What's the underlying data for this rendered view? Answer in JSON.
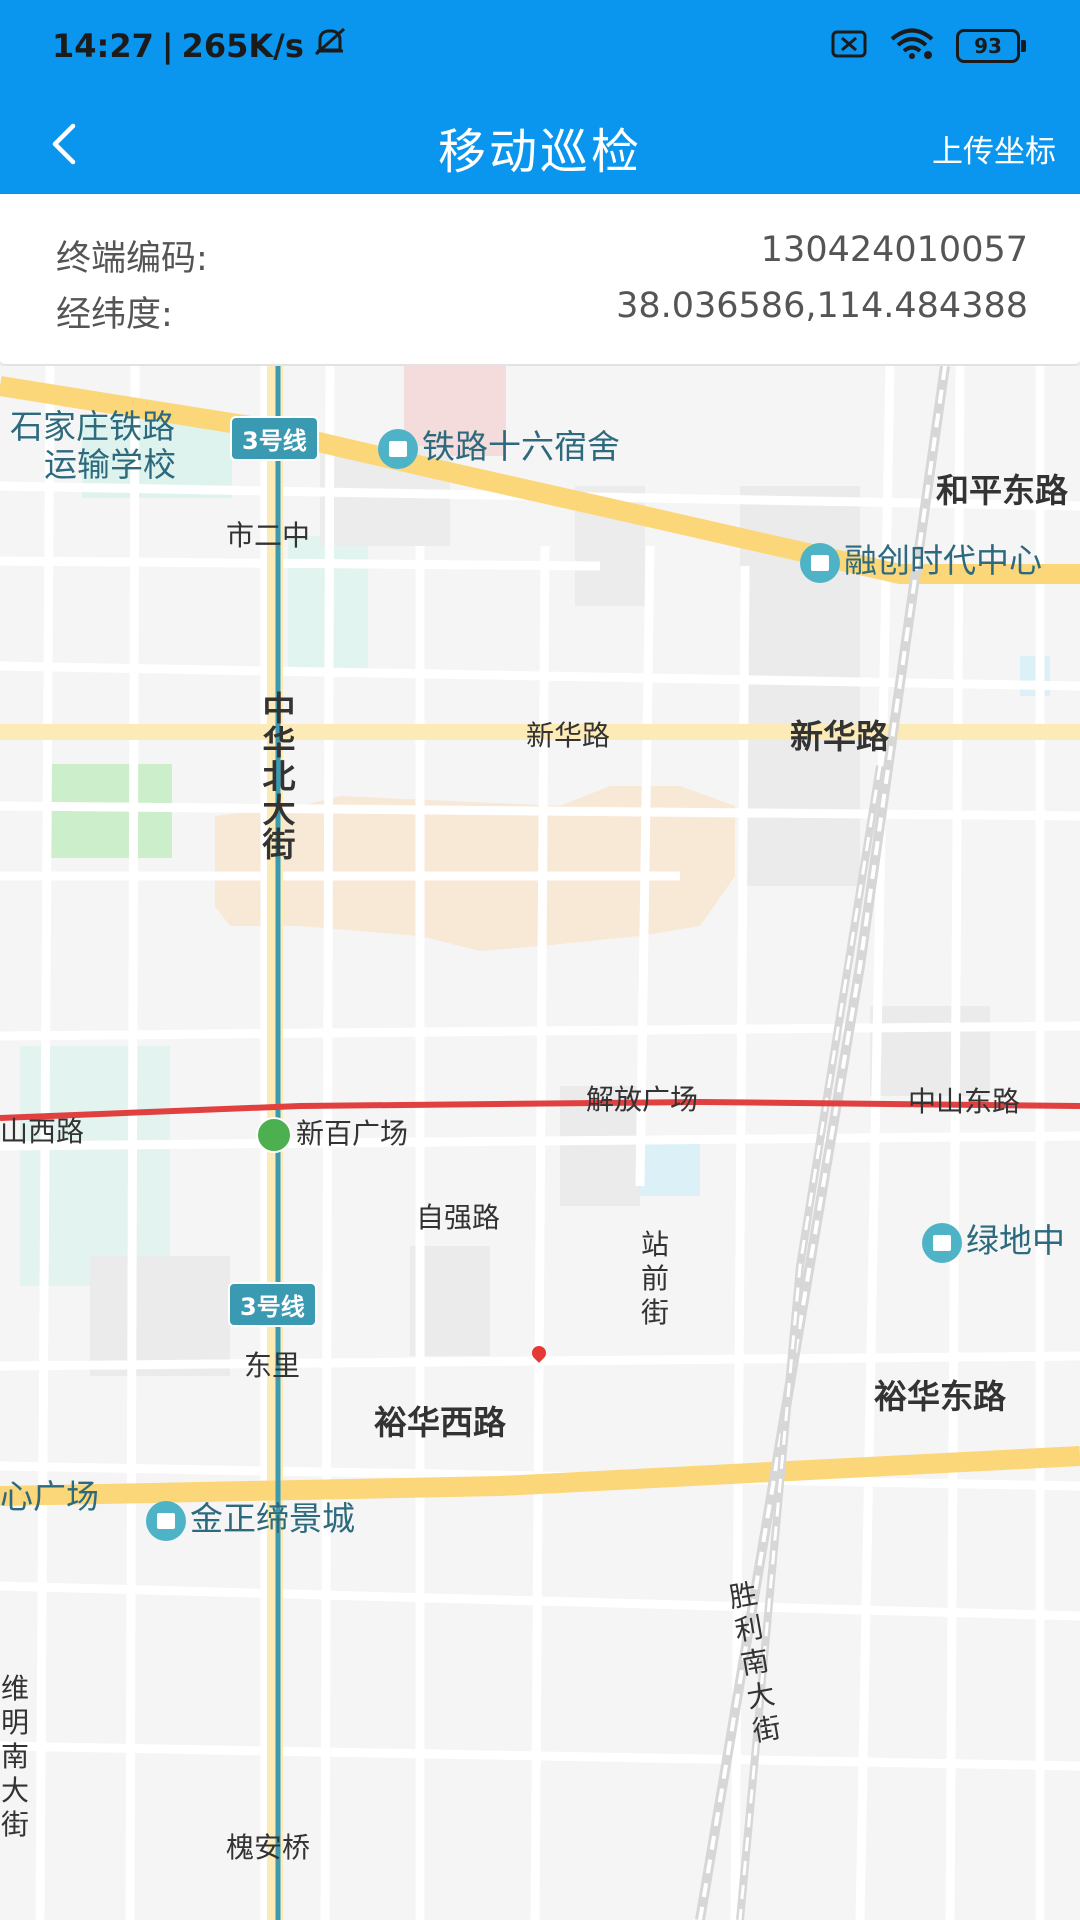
{
  "status_bar": {
    "time": "14:27",
    "speed": "265K/s",
    "battery": "93"
  },
  "app_bar": {
    "title": "移动巡检",
    "upload_label": "上传坐标"
  },
  "info": {
    "terminal_label": "终端编码:",
    "terminal_value": "130424010057",
    "latlng_label": "经纬度:",
    "latlng_value": "38.036586,114.484388"
  },
  "map": {
    "metro_line_tag": "3号线",
    "labels": {
      "school": "石家庄铁路",
      "school2": "运输学校",
      "dorm": "铁路十六宿舍",
      "heping": "和平东路",
      "shierzhong": "市二中",
      "rongchuang": "融创时代中心",
      "zhonghua": "中华北大街",
      "xinhualu_small": "新华路",
      "xinhualu_big": "新华路",
      "jiefang": "解放广场",
      "zhongshan_east": "中山东路",
      "zhongshan_west": "山西路",
      "xinbai": "新百广场",
      "ziqiang": "自强路",
      "zhanqian": "站前街",
      "lvdi": "绿地中",
      "dongli": "东里",
      "yuhua_west": "裕华西路",
      "yuhua_east": "裕华东路",
      "xinguangchang": "心广场",
      "jinzheng": "金正缔景城",
      "shengli": "胜利南大街",
      "weiming": "维明南大街",
      "huaian": "槐安桥"
    }
  },
  "colors": {
    "primary": "#0a95ee",
    "metro_line": "#3a9ab2",
    "subway_red": "#e04040",
    "main_road": "#fbd77a"
  }
}
